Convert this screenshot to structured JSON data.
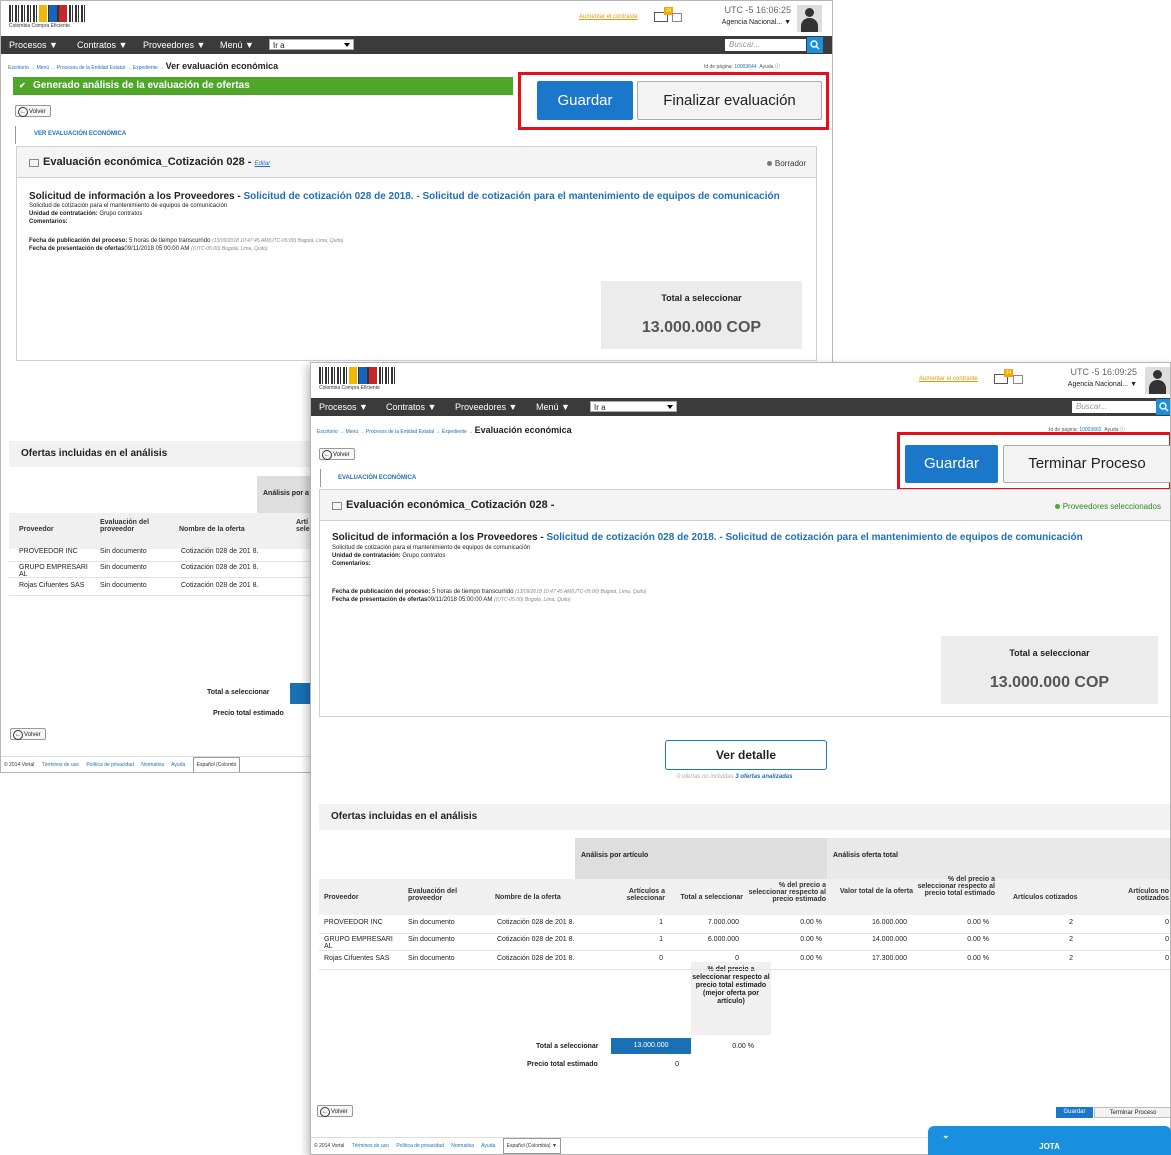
{
  "header": {
    "logo_caption": "Colombia Compra Eficiente",
    "contrast_link": "Aumentar el contraste",
    "mail_badge": "24",
    "agency": "Agencia Nacional...",
    "back_time": "UTC -5 16:06:25",
    "front_time": "UTC -5 16:09:25"
  },
  "nav": {
    "items": [
      "Procesos ▼",
      "Contratos ▼",
      "Proveedores ▼",
      "Menú ▼"
    ],
    "ira": "Ir a",
    "search_placeholder": "Buscar..."
  },
  "back": {
    "crumb_links": "Escritorio → Menú → Procesos de la Entidad Estatal → Expediente →",
    "crumb_current": "Ver evaluación económica",
    "page_id_label": "Id de página:",
    "page_id": "10003644",
    "help": "Ayuda",
    "green_bar": "Generado análisis de la evaluación de ofertas",
    "section_link": "VER EVALUACIÓN ECONÓMICA",
    "btn_save": "Guardar",
    "btn_finish": "Finalizar evaluación",
    "panel_title": "Evaluación económica_Cotización 028 -",
    "edit": "Editar",
    "status": "Borrador",
    "total_label": "Total a seleccionar",
    "total_value": "13.000.000 COP",
    "offers_title": "Ofertas incluidas en el análisis",
    "group_art": "Análisis por a",
    "col_art_a": "Artí",
    "col_art_b": "selec",
    "sum_total_label": "Total a seleccionar",
    "sum_price_label": "Precio total estimado",
    "footer_lang": "Español (Colombi"
  },
  "front": {
    "crumb_links": "Escritorio → Menú → Procesos de la Entidad Estatal → Expediente →",
    "crumb_current": "Evaluación económica",
    "page_id_label": "Id de página:",
    "page_id": "10003662",
    "help": "Ayuda",
    "section_link": "EVALUACIÓN ECONÓMICA",
    "btn_save": "Guardar",
    "btn_finish": "Terminar Proceso",
    "panel_title": "Evaluación económica_Cotización 028 -",
    "status": "Proveedores seleccionados",
    "total_label": "Total a seleccionar",
    "total_value": "13.000.000 COP",
    "detail_btn": "Ver detalle",
    "detail_note_a": "0 ofertas no incluidas",
    "detail_note_b": "3 ofertas analizadas",
    "offers_title": "Ofertas incluidas en el análisis",
    "group_art": "Análisis por artículo",
    "group_total": "Análisis oferta total",
    "columns": {
      "proveedor": "Proveedor",
      "evaluacion": "Evaluación del proveedor",
      "nombre": "Nombre de la oferta",
      "art_sel": "Artículos a seleccionar",
      "total_sel": "Total a seleccionar",
      "pct_est": "% del precio a seleccionar respecto al precio estimado",
      "valor_total": "Valor total de la oferta",
      "pct_total": "% del precio a seleccionar respecto al precio total estimado",
      "art_cot": "Artículos cotizados",
      "art_no": "Artículos no cotizados"
    },
    "sum_pct_header": "% del precio a seleccionar respecto al precio total estimado (mejor oferta por artículo)",
    "sum_total_label": "Total a seleccionar",
    "sum_total_value": "13.000.000",
    "sum_total_pct": "0.00 %",
    "sum_price_label": "Precio total estimado",
    "sum_price_value": "0",
    "bottom_save": "Guardar",
    "bottom_finish": "Terminar Proceso",
    "footer_lang": "Español (Colombia) ▼"
  },
  "shared": {
    "volver": "Volver",
    "sol_prefix": "Solicitud de información a los Proveedores -",
    "sol_link": "Solicitud de cotización 028 de 2018. - Solicitud de cotización para el mantenimiento de equipos de comunicación",
    "sol_desc": "Solicitud de cotización para el mantenimiento de equipos de comunicación",
    "unidad_label": "Unidad de contratación:",
    "unidad_value": "Grupo contratos",
    "comentarios": "Comentarios:",
    "pub_label": "Fecha de publicación del proceso:",
    "pub_value": "5 horas de tiempo transcurrido",
    "pub_tz": "(13/09/2018 10:47:45 AM(UTC-05:00) Bogotá, Lima, Quito)",
    "pres_label": "Fecha de presentación de ofertas",
    "pres_value": "09/11/2018 05:00:00 AM",
    "pres_tz": "((UTC-05:00) Bogotá, Lima, Quito)",
    "footer_copy": "© 2014 Vortal",
    "footer_links": [
      "Términos de uso",
      "Política de privacidad",
      "Normativa",
      "Ayuda"
    ],
    "providers": [
      {
        "name": "PROVEEDOR INC",
        "eval": "Sin documento",
        "offer": "Cotización 028 de 201 8.",
        "art_sel": "1",
        "total_sel": "7.000.000",
        "pct": "0.00 %",
        "valor": "16.000.000",
        "pct_total": "0.00 %",
        "cot": "2",
        "no_cot": "0"
      },
      {
        "name": "GRUPO EMPRESARI AL",
        "eval": "Sin documento",
        "offer": "Cotización 028 de 201 8.",
        "art_sel": "1",
        "total_sel": "6.000.000",
        "pct": "0.00 %",
        "valor": "14.000.000",
        "pct_total": "0.00 %",
        "cot": "2",
        "no_cot": "0"
      },
      {
        "name": "Rojas Cifuentes SAS",
        "eval": "Sin documento",
        "offer": "Cotización 028 de 201 8.",
        "art_sel": "0",
        "total_sel": "0",
        "pct": "0.00 %",
        "valor": "17.300.000",
        "pct_total": "0.00 %",
        "cot": "2",
        "no_cot": "0"
      }
    ]
  },
  "chat": {
    "label": "JOTA"
  },
  "colors": {
    "green": "#4fa628",
    "blue": "#1a77c9",
    "red": "#e3101a",
    "nav": "#3b3b3b"
  }
}
